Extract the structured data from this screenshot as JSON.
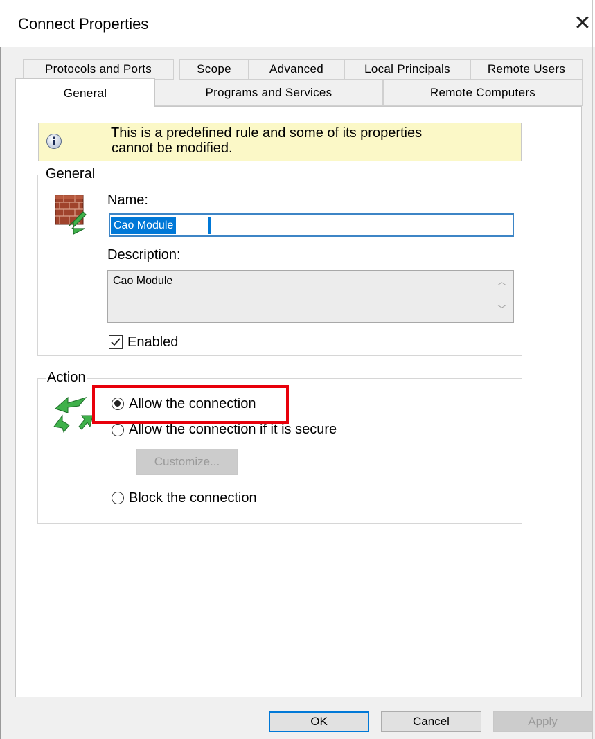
{
  "window": {
    "title": "Connect Properties",
    "close_glyph": "✕"
  },
  "tabs_row1": [
    "Protocols and Ports",
    "Scope",
    "Advanced",
    "Local Principals",
    "Remote Users"
  ],
  "tabs_row2": [
    "General",
    "Programs and Services",
    "Remote Computers"
  ],
  "active_tab": "General",
  "info": {
    "icon": "info-icon",
    "text_line1": "This is a predefined rule and some of its properties",
    "text_line2": "cannot be modified."
  },
  "general_group": {
    "legend": "General",
    "icon": "firewall-rule-icon",
    "name_label": "Name:",
    "name_value": "Cao Module",
    "description_label": "Description:",
    "description_value": "Cao Module",
    "enabled_label": "Enabled",
    "enabled": true
  },
  "action_group": {
    "legend": "Action",
    "icon": "allow-arrows-icon",
    "options": [
      {
        "label": "Allow the connection",
        "selected": true
      },
      {
        "label": "Allow the connection if it is secure",
        "selected": false
      },
      {
        "label": "Block the connection",
        "selected": false
      }
    ],
    "customize_label": "Customize..."
  },
  "footer": {
    "ok": "OK",
    "cancel": "Cancel",
    "apply": "Apply"
  },
  "colors": {
    "accent": "#0078d7",
    "highlight": "#e8000b",
    "info_bg": "#fbf8c7"
  }
}
